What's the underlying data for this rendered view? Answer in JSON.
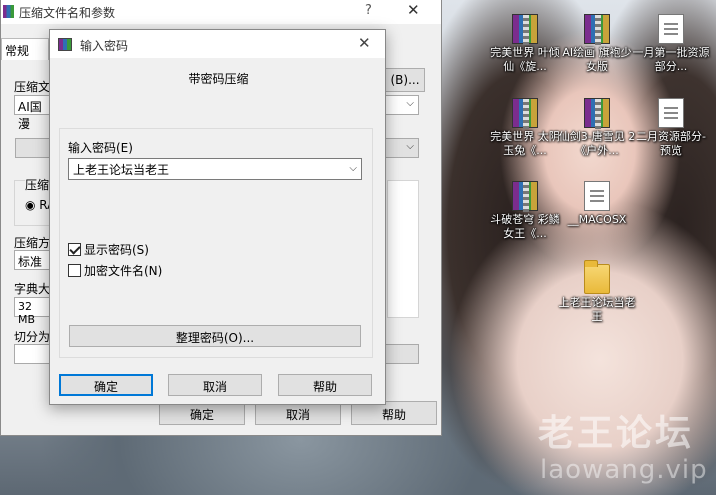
{
  "desktop": {
    "icons": [
      {
        "label": "完美世界 叶倾仙《旋...",
        "type": "rar"
      },
      {
        "label": "AI绘画 旗袍少女版",
        "type": "rar"
      },
      {
        "label": "一月第一批资源部分...",
        "type": "file"
      },
      {
        "label": "完美世界 太阴玉兔《...",
        "type": "rar"
      },
      {
        "label": "仙剑3-唐雪见 2《户外...",
        "type": "rar"
      },
      {
        "label": "二月资源部分-预览",
        "type": "file"
      },
      {
        "label": "斗破苍穹 彩鳞女王《...",
        "type": "rar"
      },
      {
        "label": "__MACOSX",
        "type": "file"
      },
      {
        "label": "上老王论坛当老王",
        "type": "folder"
      }
    ],
    "watermark_cn": "老王论坛",
    "watermark_en": "laowang.vip"
  },
  "main_dialog": {
    "title": "压缩文件名和参数",
    "help": "?",
    "close": "✕",
    "tab_general": "常规",
    "archive_name_label": "压缩文",
    "archive_name_value": "AI国漫",
    "browse_button": "(B)...",
    "compress_format_label": "压缩",
    "rar_option": "RA",
    "method_label": "压缩方",
    "method_value": "标准",
    "dict_label": "字典大",
    "dict_value": "32 MB",
    "split_label": "切分为",
    "ok": "确定",
    "cancel": "取消",
    "help_button": "帮助"
  },
  "password_dialog": {
    "title": "输入密码",
    "close": "✕",
    "heading": "带密码压缩",
    "password_label": "输入密码(E)",
    "password_value": "上老王论坛当老王",
    "show_password": "显示密码(S)",
    "show_password_checked": true,
    "encrypt_filenames": "加密文件名(N)",
    "encrypt_filenames_checked": false,
    "organize_button": "整理密码(O)...",
    "ok": "确定",
    "cancel": "取消",
    "help": "帮助"
  }
}
